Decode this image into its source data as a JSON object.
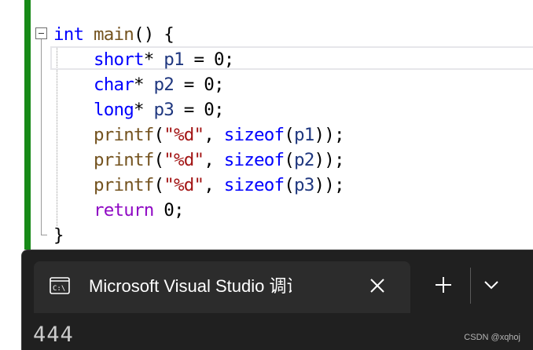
{
  "editor": {
    "lines": [
      [
        {
          "t": "int",
          "c": "kw"
        },
        {
          "t": " ",
          "c": "pl"
        },
        {
          "t": "main",
          "c": "fn"
        },
        {
          "t": "() {",
          "c": "pl"
        }
      ],
      [
        {
          "t": "    ",
          "c": "pl"
        },
        {
          "t": "short",
          "c": "kw"
        },
        {
          "t": "* ",
          "c": "pl"
        },
        {
          "t": "p1",
          "c": "var"
        },
        {
          "t": " = 0;",
          "c": "pl"
        }
      ],
      [
        {
          "t": "    ",
          "c": "pl"
        },
        {
          "t": "char",
          "c": "kw"
        },
        {
          "t": "* ",
          "c": "pl"
        },
        {
          "t": "p2",
          "c": "var"
        },
        {
          "t": " = 0;",
          "c": "pl"
        }
      ],
      [
        {
          "t": "    ",
          "c": "pl"
        },
        {
          "t": "long",
          "c": "kw"
        },
        {
          "t": "* ",
          "c": "pl"
        },
        {
          "t": "p3",
          "c": "var"
        },
        {
          "t": " = 0;",
          "c": "pl"
        }
      ],
      [
        {
          "t": "    ",
          "c": "pl"
        },
        {
          "t": "printf",
          "c": "fn"
        },
        {
          "t": "(",
          "c": "pl"
        },
        {
          "t": "\"%d\"",
          "c": "str"
        },
        {
          "t": ", ",
          "c": "pl"
        },
        {
          "t": "sizeof",
          "c": "kw"
        },
        {
          "t": "(",
          "c": "pl"
        },
        {
          "t": "p1",
          "c": "var"
        },
        {
          "t": "));",
          "c": "pl"
        }
      ],
      [
        {
          "t": "    ",
          "c": "pl"
        },
        {
          "t": "printf",
          "c": "fn"
        },
        {
          "t": "(",
          "c": "pl"
        },
        {
          "t": "\"%d\"",
          "c": "str"
        },
        {
          "t": ", ",
          "c": "pl"
        },
        {
          "t": "sizeof",
          "c": "kw"
        },
        {
          "t": "(",
          "c": "pl"
        },
        {
          "t": "p2",
          "c": "var"
        },
        {
          "t": "));",
          "c": "pl"
        }
      ],
      [
        {
          "t": "    ",
          "c": "pl"
        },
        {
          "t": "printf",
          "c": "fn"
        },
        {
          "t": "(",
          "c": "pl"
        },
        {
          "t": "\"%d\"",
          "c": "str"
        },
        {
          "t": ", ",
          "c": "pl"
        },
        {
          "t": "sizeof",
          "c": "kw"
        },
        {
          "t": "(",
          "c": "pl"
        },
        {
          "t": "p3",
          "c": "var"
        },
        {
          "t": "));",
          "c": "pl"
        }
      ],
      [
        {
          "t": "    ",
          "c": "pl"
        },
        {
          "t": "return",
          "c": "kw2"
        },
        {
          "t": " 0;",
          "c": "pl"
        }
      ],
      [
        {
          "t": "}",
          "c": "pl"
        }
      ]
    ],
    "colors": {
      "keyword": "#0000ff",
      "control_keyword": "#8f08c4",
      "function": "#74531f",
      "string": "#a31515",
      "variable": "#1f377f",
      "change_bar": "#178a17"
    }
  },
  "terminal": {
    "tab_title": "Microsoft Visual Studio 调试控制台",
    "tab_icon": "console-icon",
    "close_icon": "close-icon",
    "new_tab_icon": "plus-icon",
    "dropdown_icon": "chevron-down-icon",
    "output": "444",
    "background": "#202020"
  },
  "watermark": "CSDN @xqhoj"
}
